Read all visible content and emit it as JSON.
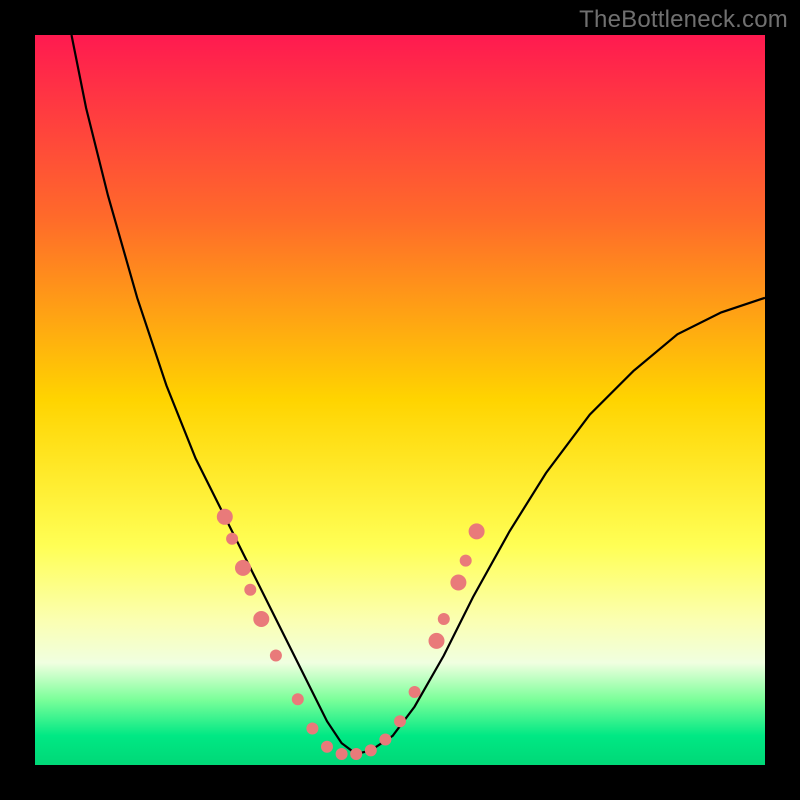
{
  "watermark": "TheBottleneck.com",
  "chart_data": {
    "type": "line",
    "title": "",
    "xlabel": "",
    "ylabel": "",
    "xlim": [
      0,
      100
    ],
    "ylim": [
      0,
      100
    ],
    "gradient_stops": [
      {
        "offset": 0,
        "color": "#ff1a50"
      },
      {
        "offset": 25,
        "color": "#ff6a2a"
      },
      {
        "offset": 50,
        "color": "#ffd400"
      },
      {
        "offset": 70,
        "color": "#ffff55"
      },
      {
        "offset": 80,
        "color": "#fbffb0"
      },
      {
        "offset": 86,
        "color": "#f0ffe0"
      },
      {
        "offset": 91,
        "color": "#7cff9a"
      },
      {
        "offset": 96,
        "color": "#00e884"
      },
      {
        "offset": 100,
        "color": "#00d877"
      }
    ],
    "series": [
      {
        "name": "bottleneck-curve",
        "x": [
          5,
          7,
          10,
          14,
          18,
          22,
          26,
          30,
          33,
          36,
          38,
          40,
          42,
          44,
          46,
          49,
          52,
          56,
          60,
          65,
          70,
          76,
          82,
          88,
          94,
          100
        ],
        "y": [
          100,
          90,
          78,
          64,
          52,
          42,
          34,
          26,
          20,
          14,
          10,
          6,
          3,
          1.5,
          2,
          4,
          8,
          15,
          23,
          32,
          40,
          48,
          54,
          59,
          62,
          64
        ]
      }
    ],
    "markers": {
      "name": "highlight-points",
      "color": "#e97a7a",
      "radius_small": 6,
      "radius_large": 8,
      "points": [
        {
          "x": 26,
          "y": 34,
          "r": "large"
        },
        {
          "x": 27,
          "y": 31,
          "r": "small"
        },
        {
          "x": 28.5,
          "y": 27,
          "r": "large"
        },
        {
          "x": 29.5,
          "y": 24,
          "r": "small"
        },
        {
          "x": 31,
          "y": 20,
          "r": "large"
        },
        {
          "x": 33,
          "y": 15,
          "r": "small"
        },
        {
          "x": 36,
          "y": 9,
          "r": "small"
        },
        {
          "x": 38,
          "y": 5,
          "r": "small"
        },
        {
          "x": 40,
          "y": 2.5,
          "r": "small"
        },
        {
          "x": 42,
          "y": 1.5,
          "r": "small"
        },
        {
          "x": 44,
          "y": 1.5,
          "r": "small"
        },
        {
          "x": 46,
          "y": 2,
          "r": "small"
        },
        {
          "x": 48,
          "y": 3.5,
          "r": "small"
        },
        {
          "x": 50,
          "y": 6,
          "r": "small"
        },
        {
          "x": 52,
          "y": 10,
          "r": "small"
        },
        {
          "x": 55,
          "y": 17,
          "r": "large"
        },
        {
          "x": 56,
          "y": 20,
          "r": "small"
        },
        {
          "x": 58,
          "y": 25,
          "r": "large"
        },
        {
          "x": 59,
          "y": 28,
          "r": "small"
        },
        {
          "x": 60.5,
          "y": 32,
          "r": "large"
        }
      ]
    }
  }
}
